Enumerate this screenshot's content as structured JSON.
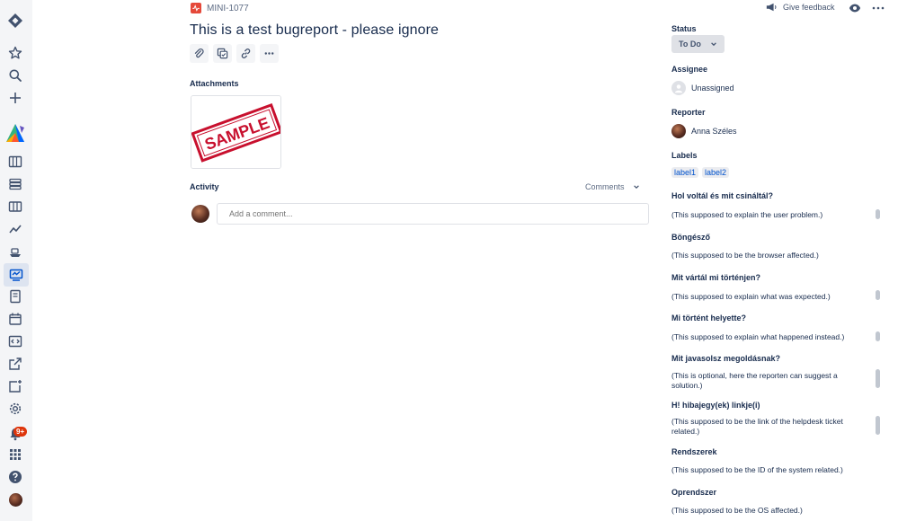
{
  "nav": {
    "badge": "9+",
    "items": [
      "jira-logo-icon",
      "star-icon",
      "search-icon",
      "create-icon",
      "project-avatar-icon",
      "board-icon",
      "backlog-icon",
      "roadmap-icon",
      "reports-icon",
      "releases-icon",
      "issues-icon",
      "pages-icon",
      "calendar-icon",
      "code-icon",
      "external-link-icon",
      "add-shortcut-icon",
      "settings-icon",
      "notifications-icon",
      "apps-icon",
      "help-icon",
      "profile-icon"
    ]
  },
  "issue": {
    "key": "MINI-1077",
    "title": "This is a test bugreport - please ignore",
    "toolbar": [
      "attach-icon",
      "subtask-icon",
      "link-icon",
      "more-icon"
    ],
    "attachments_label": "Attachments",
    "attachment_text": "SAMPLE",
    "activity_label": "Activity",
    "comments_toggle": "Comments",
    "comment_placeholder": "Add a comment..."
  },
  "header": {
    "feedback": "Give feedback"
  },
  "details": {
    "status_label": "Status",
    "status_value": "To Do",
    "assignee_label": "Assignee",
    "assignee_value": "Unassigned",
    "reporter_label": "Reporter",
    "reporter_value": "Anna Széles",
    "labels_label": "Labels",
    "labels": [
      "label1",
      "label2"
    ],
    "fields": [
      {
        "label": "Hol voltál és mit csináltál?",
        "value": "(This supposed to explain the user problem.)"
      },
      {
        "label": "Böngésző",
        "value": "(This supposed to be the browser affected.)"
      },
      {
        "label": "Mit vártál mi történjen?",
        "value": "(This supposed to explain what was expected.)"
      },
      {
        "label": "Mi történt helyette?",
        "value": "(This supposed to explain what happened instead.)"
      },
      {
        "label": "Mit javasolsz megoldásnak?",
        "value": "(This is optional, here the reporten can suggest a solution.)"
      },
      {
        "label": "H! hibajegy(ek) linkje(i)",
        "value": "(This supposed to be the link of the helpdesk ticket related.)"
      },
      {
        "label": "Rendszerek",
        "value": "(This supposed to be the ID of the system related.)"
      },
      {
        "label": "Oprendszer",
        "value": "(This supposed to be the OS affected.)"
      }
    ]
  },
  "colors": {
    "accent": "#0052cc",
    "bug": "#e5493a",
    "rail": "#f4f5f7"
  }
}
